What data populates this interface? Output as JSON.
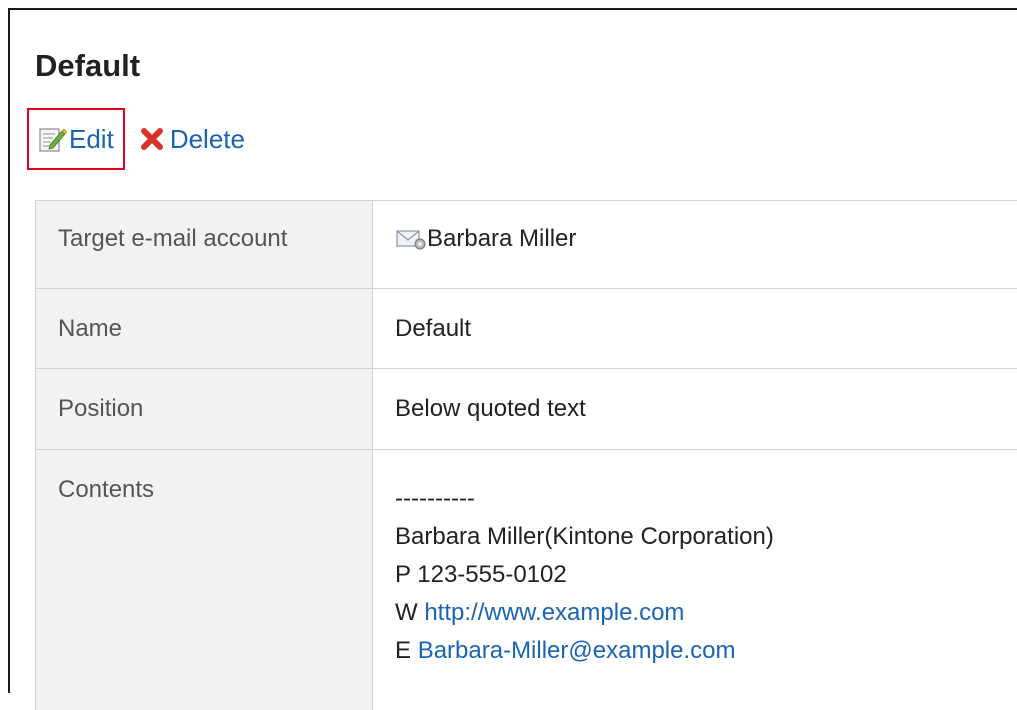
{
  "page": {
    "title": "Default"
  },
  "actions": {
    "edit_label": "Edit",
    "delete_label": "Delete"
  },
  "icons": {
    "edit": "edit-icon",
    "delete": "delete-x-icon",
    "account": "mail-account-icon"
  },
  "details": {
    "target_account": {
      "label": "Target e-mail account",
      "value": "Barbara Miller"
    },
    "name": {
      "label": "Name",
      "value": "Default"
    },
    "position": {
      "label": "Position",
      "value": "Below quoted text"
    },
    "contents": {
      "label": "Contents",
      "separator": "----------",
      "line1": "Barbara Miller(Kintone Corporation)",
      "line2": "P 123-555-0102",
      "web_prefix": "W ",
      "web_url": "http://www.example.com",
      "email_prefix": "E ",
      "email": "Barbara-Miller@example.com"
    }
  },
  "colors": {
    "link": "#1a64b3",
    "highlight_border": "#e0001a",
    "label_bg": "#f2f2f2",
    "border": "#d2d2d2"
  }
}
